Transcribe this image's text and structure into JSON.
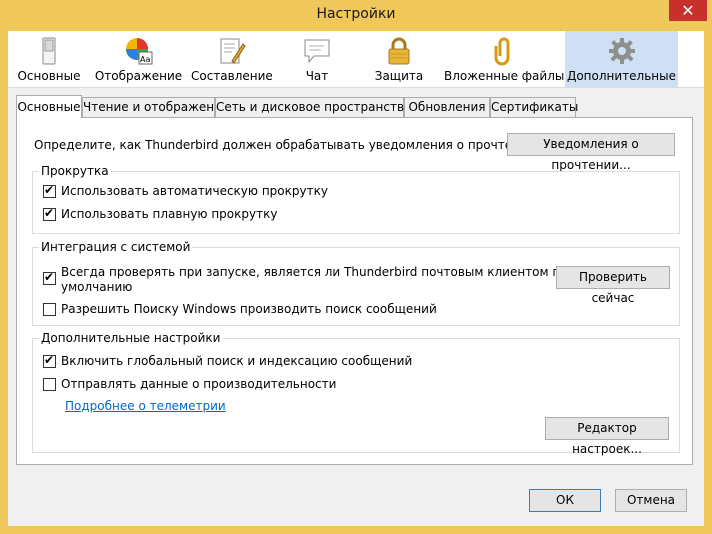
{
  "window": {
    "title": "Настройки",
    "close": "✕"
  },
  "toolbar": {
    "items": [
      {
        "label": "Основные",
        "icon": "switch-icon"
      },
      {
        "label": "Отображение",
        "icon": "color-palette-icon"
      },
      {
        "label": "Составление",
        "icon": "compose-pencil-icon"
      },
      {
        "label": "Чат",
        "icon": "chat-bubble-icon"
      },
      {
        "label": "Защита",
        "icon": "padlock-icon"
      },
      {
        "label": "Вложенные файлы",
        "icon": "paperclip-icon"
      },
      {
        "label": "Дополнительные",
        "icon": "gear-icon",
        "selected": true
      }
    ]
  },
  "tabs": [
    {
      "label": "Основные",
      "active": true
    },
    {
      "label": "Чтение и отображение"
    },
    {
      "label": "Сеть и дисковое пространство"
    },
    {
      "label": "Обновления"
    },
    {
      "label": "Сертификаты"
    }
  ],
  "main": {
    "receipts_text": "Определите, как Thunderbird должен обрабатывать уведомления о прочтении",
    "receipts_button": "Уведомления о прочтении...",
    "scrolling": {
      "title": "Прокрутка",
      "auto_scroll": {
        "label": "Использовать автоматическую прокрутку",
        "checked": true
      },
      "smooth_scroll": {
        "label": "Использовать плавную прокрутку",
        "checked": true
      }
    },
    "integration": {
      "title": "Интеграция с системой",
      "default_client": {
        "label_line1": "Всегда проверять при запуске, является ли Thunderbird почтовым клиентом по",
        "label_line2": "умолчанию",
        "checked": true
      },
      "check_now_button": "Проверить сейчас",
      "windows_search": {
        "label": "Разрешить Поиску Windows производить поиск сообщений",
        "checked": false
      }
    },
    "advanced": {
      "title": "Дополнительные настройки",
      "global_search": {
        "label": "Включить глобальный поиск и индексацию сообщений",
        "checked": true
      },
      "telemetry": {
        "label": "Отправлять данные о производительности",
        "checked": false
      },
      "telemetry_link": "Подробнее о телеметрии",
      "config_editor_button": "Редактор настроек..."
    }
  },
  "footer": {
    "ok": "ОК",
    "cancel": "Отмена"
  },
  "colors": {
    "title_bar": "#f0c75a",
    "close_button": "#c7302b",
    "selected_toolbar": "#cfe0f5",
    "link": "#0066cc"
  }
}
